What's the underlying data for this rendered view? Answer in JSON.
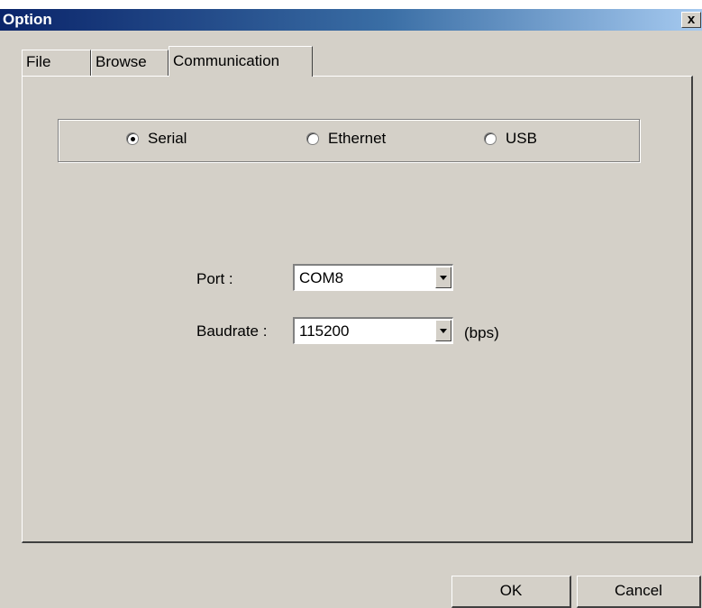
{
  "window": {
    "title": "Option",
    "close_glyph": "x"
  },
  "tabs": [
    {
      "label": "File",
      "active": false
    },
    {
      "label": "Browse",
      "active": false
    },
    {
      "label": "Communication",
      "active": true
    }
  ],
  "connection": {
    "selected": "Serial",
    "options": [
      "Serial",
      "Ethernet",
      "USB"
    ]
  },
  "port": {
    "label": "Port :",
    "value": "COM8"
  },
  "baudrate": {
    "label": "Baudrate :",
    "value": "115200",
    "unit": "(bps)"
  },
  "buttons": {
    "ok": "OK",
    "cancel": "Cancel"
  },
  "icons": {
    "close": "close-icon",
    "dropdown": "chevron-down-icon",
    "radio": "radio-icon"
  }
}
